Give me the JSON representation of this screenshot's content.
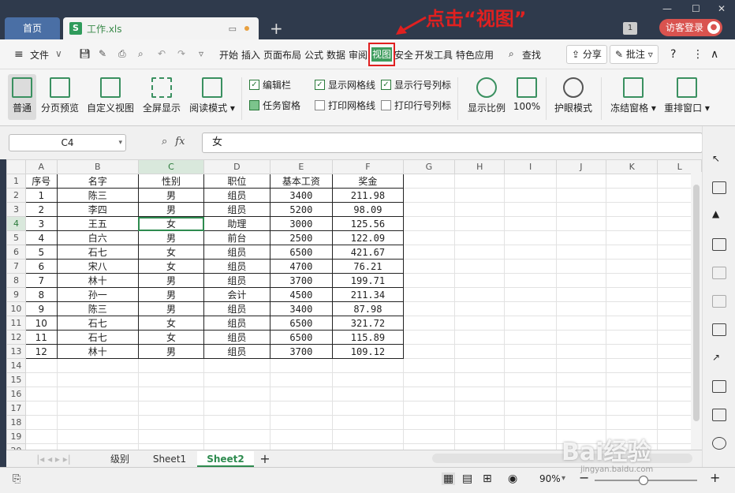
{
  "tabs": {
    "home": "首页",
    "file": "工作.xls"
  },
  "annotation": "点击“视图”",
  "account": {
    "badge": "1",
    "login": "访客登录"
  },
  "menu": {
    "file": "文件",
    "items": [
      "开始",
      "插入",
      "页面布局",
      "公式",
      "数据",
      "审阅",
      "视图",
      "安全",
      "开发工具",
      "特色应用"
    ],
    "search": "查找",
    "share": "分享",
    "comment": "批注"
  },
  "ribbon": {
    "normal": "普通",
    "page_preview": "分页预览",
    "custom_view": "自定义视图",
    "fullscreen": "全屏显示",
    "read_mode": "阅读模式",
    "edit_bar": "编辑栏",
    "show_grid": "显示网格线",
    "show_rowcol": "显示行号列标",
    "task_pane": "任务窗格",
    "print_grid": "打印网格线",
    "print_rowcol": "打印行号列标",
    "zoom_ratio": "显示比例",
    "zoom100": "100%",
    "eye_mode": "护眼模式",
    "freeze": "冻结窗格",
    "rearrange": "重排窗口"
  },
  "formula": {
    "cell": "C4",
    "fx": "fx",
    "value": "女"
  },
  "columns": [
    "A",
    "B",
    "C",
    "D",
    "E",
    "F",
    "G",
    "H",
    "I",
    "J",
    "K",
    "L"
  ],
  "header_row": [
    "序号",
    "名字",
    "性别",
    "职位",
    "基本工资",
    "奖金"
  ],
  "rows": [
    [
      "1",
      "陈三",
      "男",
      "组员",
      "3400",
      "211.98"
    ],
    [
      "2",
      "李四",
      "男",
      "组员",
      "5200",
      "98.09"
    ],
    [
      "3",
      "王五",
      "女",
      "助理",
      "3000",
      "125.56"
    ],
    [
      "4",
      "白六",
      "男",
      "前台",
      "2500",
      "122.09"
    ],
    [
      "5",
      "石七",
      "女",
      "组员",
      "6500",
      "421.67"
    ],
    [
      "6",
      "宋八",
      "女",
      "组员",
      "4700",
      "76.21"
    ],
    [
      "7",
      "林十",
      "男",
      "组员",
      "3700",
      "199.71"
    ],
    [
      "8",
      "孙一",
      "男",
      "会计",
      "4500",
      "211.34"
    ],
    [
      "9",
      "陈三",
      "男",
      "组员",
      "3400",
      "87.98"
    ],
    [
      "10",
      "石七",
      "女",
      "组员",
      "6500",
      "321.72"
    ],
    [
      "11",
      "石七",
      "女",
      "组员",
      "6500",
      "115.89"
    ],
    [
      "12",
      "林十",
      "男",
      "组员",
      "3700",
      "109.12"
    ]
  ],
  "sheets": [
    "级别",
    "Sheet1",
    "Sheet2"
  ],
  "status": {
    "zoom": "90%"
  },
  "watermark": {
    "main": "Bai经验",
    "sub": "jingyan.baidu.com"
  }
}
